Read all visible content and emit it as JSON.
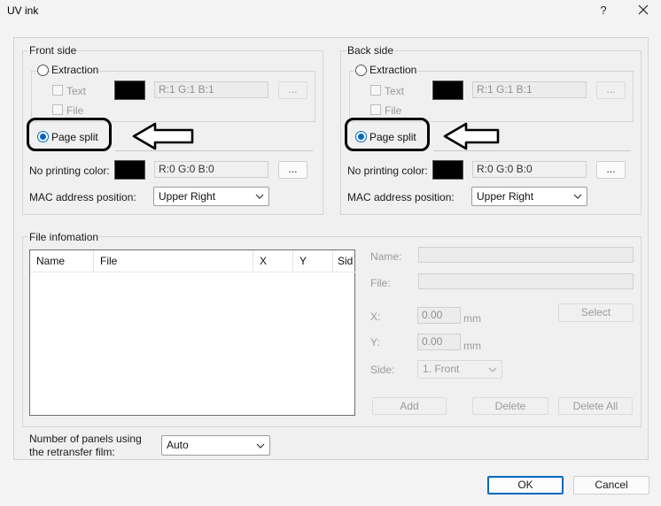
{
  "window": {
    "title": "UV ink",
    "help_label": "?"
  },
  "front": {
    "group_label": "Front side",
    "extraction_label": "Extraction",
    "text_label": "Text",
    "color_value": "R:1 G:1 B:1",
    "browse_label": "...",
    "file_label": "File",
    "page_split_label": "Page split",
    "no_print_label": "No printing color:",
    "no_print_value": "R:0 G:0 B:0",
    "no_print_browse": "...",
    "mac_label": "MAC address position:",
    "mac_value": "Upper Right"
  },
  "back": {
    "group_label": "Back side",
    "extraction_label": "Extraction",
    "text_label": "Text",
    "color_value": "R:1 G:1 B:1",
    "browse_label": "...",
    "file_label": "File",
    "page_split_label": "Page split",
    "no_print_label": "No printing color:",
    "no_print_value": "R:0 G:0 B:0",
    "no_print_browse": "...",
    "mac_label": "MAC address position:",
    "mac_value": "Upper Right"
  },
  "file_info": {
    "group_label": "File infomation",
    "columns": [
      "Name",
      "File",
      "X",
      "Y",
      "Sid"
    ],
    "name_label": "Name:",
    "file_label": "File:",
    "x_label": "X:",
    "x_value": "0.00",
    "x_unit": "mm",
    "y_label": "Y:",
    "y_value": "0.00",
    "y_unit": "mm",
    "select_label": "Select",
    "side_label": "Side:",
    "side_value": "1. Front",
    "add_label": "Add",
    "delete_label": "Delete",
    "delete_all_label": "Delete All"
  },
  "panels": {
    "label_line1": "Number of panels using",
    "label_line2": "the retransfer film:",
    "value": "Auto"
  },
  "footer": {
    "ok_label": "OK",
    "cancel_label": "Cancel"
  },
  "colors": {
    "accent": "#0067c0",
    "swatch": "#000000"
  }
}
